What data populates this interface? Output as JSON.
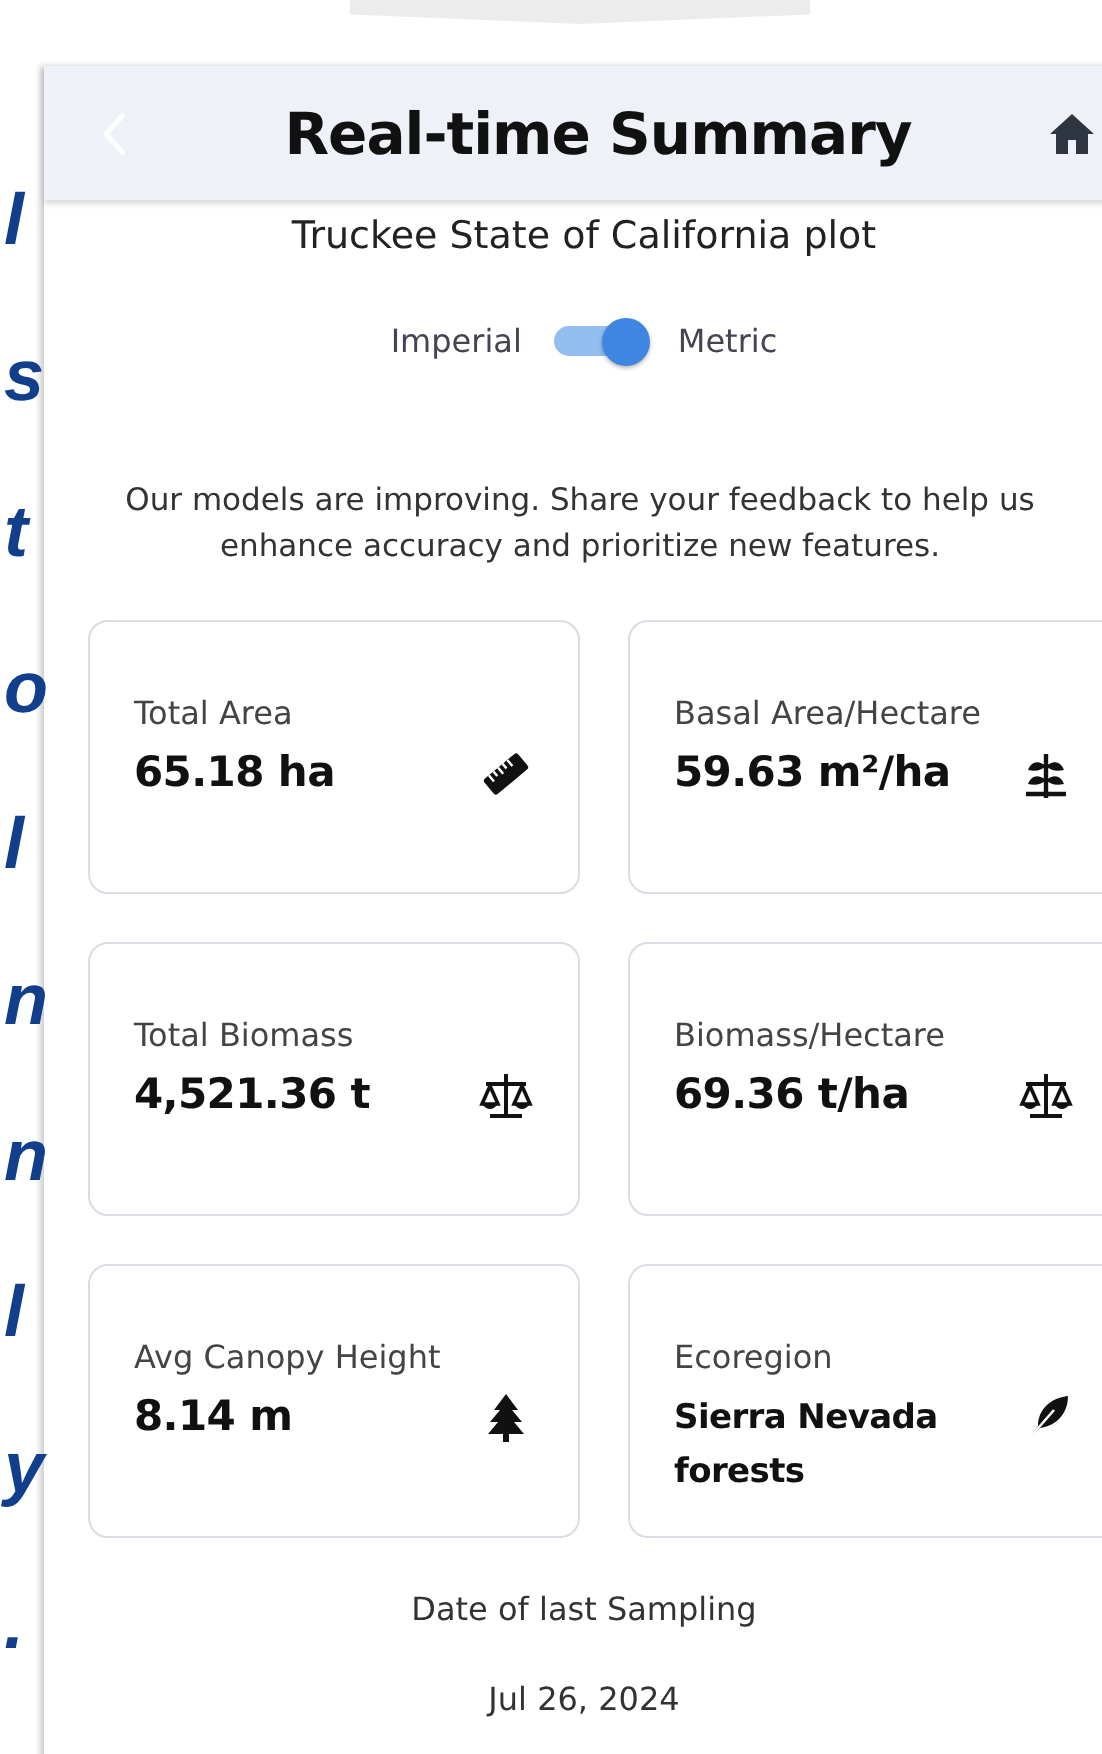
{
  "side_text": [
    "l",
    "s",
    "t",
    "o",
    "l",
    "n",
    "n",
    "l",
    "y",
    "."
  ],
  "header": {
    "title": "Real-time Summary"
  },
  "plot_name": "Truckee State of California plot",
  "units_toggle": {
    "left_label": "Imperial",
    "right_label": "Metric",
    "on": true
  },
  "message": "Our models are improving. Share your feedback to help us enhance accuracy and prioritize new features.",
  "cards": [
    {
      "label": "Total Area",
      "value": "65.18 ha"
    },
    {
      "label": "Basal Area/Hectare",
      "value": "59.63 m²/ha"
    },
    {
      "label": "Total Biomass",
      "value": "4,521.36 t"
    },
    {
      "label": "Biomass/Hectare",
      "value": "69.36 t/ha"
    },
    {
      "label": "Avg Canopy Height",
      "value": "8.14 m"
    },
    {
      "label": "Ecoregion",
      "value": "Sierra Nevada forests",
      "kind": "text"
    }
  ],
  "sampling": {
    "label": "Date of last Sampling",
    "date": "Jul 26, 2024"
  }
}
